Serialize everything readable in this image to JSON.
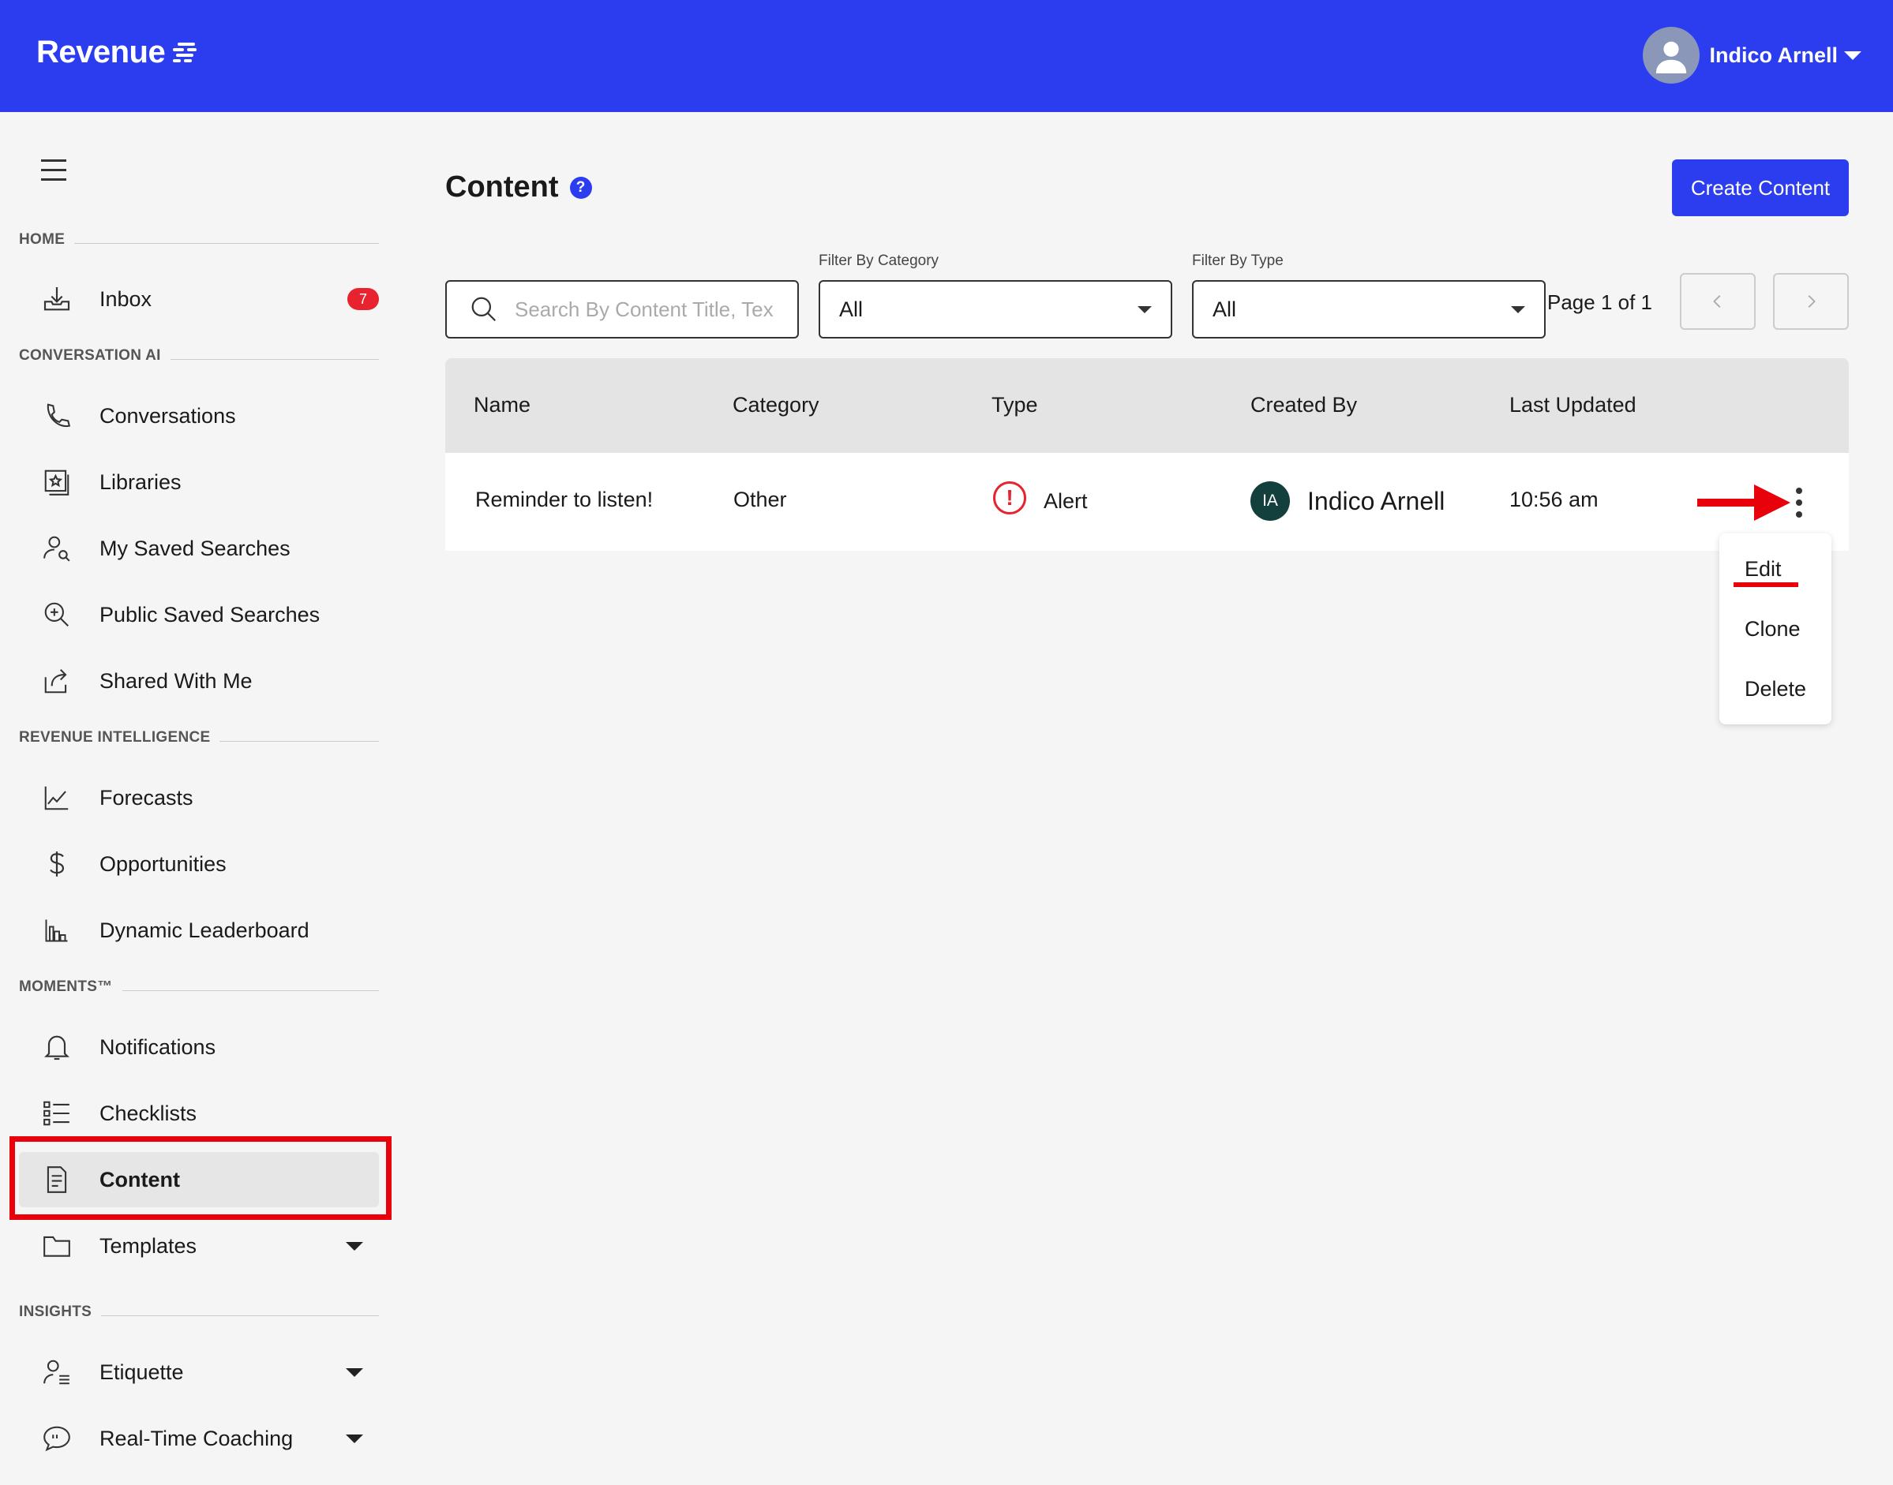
{
  "header": {
    "logo_text": "Revenue",
    "user_name": "Indico Arnell",
    "brand_color": "#2c3df0"
  },
  "sidebar": {
    "sections": {
      "home": "HOME",
      "conversation_ai": "CONVERSATION AI",
      "revenue_intelligence": "REVENUE INTELLIGENCE",
      "moments": "MOMENTS™",
      "insights": "INSIGHTS"
    },
    "items": {
      "inbox": {
        "label": "Inbox",
        "badge": "7",
        "icon": "inbox-download-icon"
      },
      "conversations": {
        "label": "Conversations",
        "icon": "phone-icon"
      },
      "libraries": {
        "label": "Libraries",
        "icon": "library-star-icon"
      },
      "my_saved_searches": {
        "label": "My Saved Searches",
        "icon": "user-search-icon"
      },
      "public_saved_searches": {
        "label": "Public Saved Searches",
        "icon": "zoom-plus-icon"
      },
      "shared_with_me": {
        "label": "Shared With Me",
        "icon": "share-icon"
      },
      "forecasts": {
        "label": "Forecasts",
        "icon": "line-chart-icon"
      },
      "opportunities": {
        "label": "Opportunities",
        "icon": "dollar-icon"
      },
      "dynamic_leaderboard": {
        "label": "Dynamic Leaderboard",
        "icon": "bar-chart-icon"
      },
      "notifications": {
        "label": "Notifications",
        "icon": "bell-icon"
      },
      "checklists": {
        "label": "Checklists",
        "icon": "checklist-icon"
      },
      "content": {
        "label": "Content",
        "icon": "document-icon",
        "active": true
      },
      "templates": {
        "label": "Templates",
        "icon": "folder-icon"
      },
      "etiquette": {
        "label": "Etiquette",
        "icon": "user-list-icon"
      },
      "realtime_coaching": {
        "label": "Real-Time Coaching",
        "icon": "speech-bubble-icon"
      }
    }
  },
  "main": {
    "title": "Content",
    "help_glyph": "?",
    "create_button": "Create Content",
    "search_placeholder": "Search By Content Title, Tex",
    "filter_category": {
      "label": "Filter By Category",
      "value": "All"
    },
    "filter_type": {
      "label": "Filter By Type",
      "value": "All"
    },
    "pagination": "Page 1 of 1",
    "table": {
      "headers": [
        "Name",
        "Category",
        "Type",
        "Created By",
        "Last Updated"
      ],
      "rows": [
        {
          "name": "Reminder to listen!",
          "category": "Other",
          "type": "Alert",
          "creator_initials": "IA",
          "creator": "Indico Arnell",
          "updated": "10:56 am"
        }
      ]
    },
    "row_menu": [
      "Edit",
      "Clone",
      "Delete"
    ]
  }
}
